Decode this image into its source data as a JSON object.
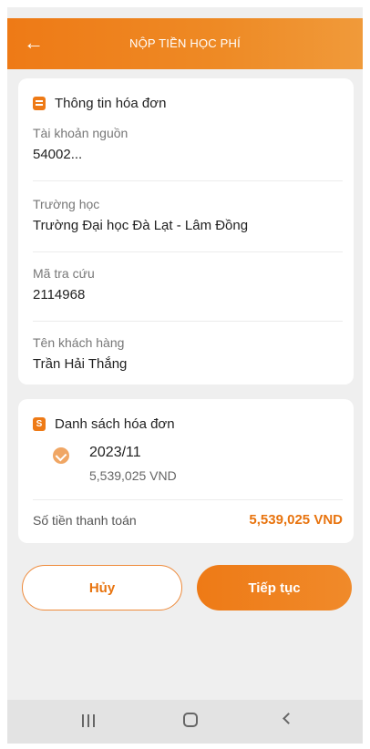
{
  "header": {
    "title": "NỘP TIỀN HỌC PHÍ",
    "back_icon": "arrow-left-icon"
  },
  "invoice_info": {
    "title": "Thông tin hóa đơn",
    "icon": "receipt-icon",
    "fields": [
      {
        "label": "Tài khoản nguồn",
        "value": "54002..."
      },
      {
        "label": "Trường học",
        "value": "Trường Đại học Đà Lạt - Lâm Đồng"
      },
      {
        "label": "Mã tra cứu",
        "value": "2114968"
      },
      {
        "label": "Tên khách hàng",
        "value": "Trần Hải Thắng"
      }
    ]
  },
  "invoice_list": {
    "title": "Danh sách hóa đơn",
    "icon": "list-icon",
    "icon_glyph": "S",
    "items": [
      {
        "period": "2023/11",
        "amount": "5,539,025 VND"
      }
    ],
    "total_label": "Số tiền thanh toán",
    "total_value": "5,539,025 VND"
  },
  "actions": {
    "cancel_label": "Hủy",
    "continue_label": "Tiếp tục"
  },
  "colors": {
    "accent": "#ee7a16",
    "background": "#efefef"
  }
}
